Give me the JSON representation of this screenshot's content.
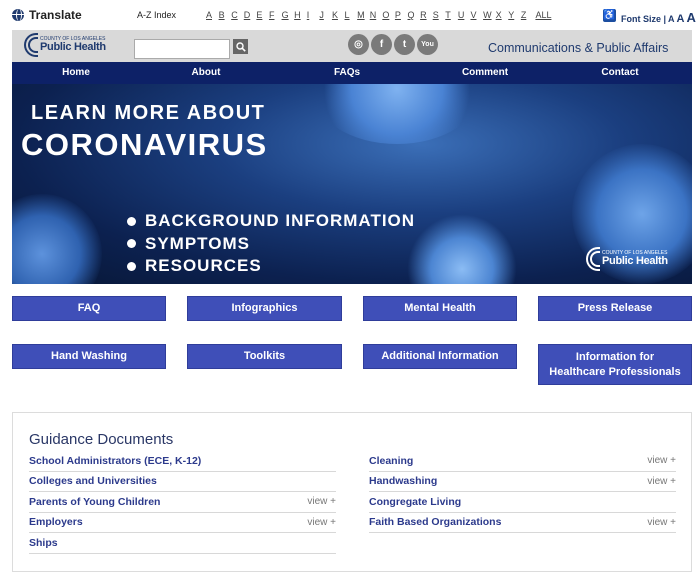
{
  "topbar": {
    "translate_label": "Translate",
    "az_label": "A-Z Index",
    "letters": [
      "A",
      "B",
      "C",
      "D",
      "E",
      "F",
      "G",
      "H",
      "I",
      "J",
      "K",
      "L",
      "M",
      "N",
      "O",
      "P",
      "Q",
      "R",
      "S",
      "T",
      "U",
      "V",
      "W",
      "X",
      "Y",
      "Z"
    ],
    "all_label": "ALL",
    "font_size_label": "Font Size |",
    "font_size_options": [
      "A",
      "A",
      "A"
    ]
  },
  "header": {
    "logo_small": "COUNTY OF LOS ANGELES",
    "logo_big": "Public Health",
    "search": {
      "value": "",
      "placeholder": ""
    },
    "social_icons": [
      "instagram-icon",
      "facebook-icon",
      "twitter-icon",
      "youtube-icon"
    ],
    "social_glyphs": [
      "◎",
      "f",
      "t",
      "You"
    ],
    "dept_title": "Communications & Public Affairs"
  },
  "nav": {
    "items": [
      "Home",
      "About",
      "FAQs",
      "Comment",
      "Contact"
    ]
  },
  "hero": {
    "line1": "LEARN MORE ABOUT",
    "line2": "CORONAVIRUS",
    "bullets": [
      "BACKGROUND INFORMATION",
      "SYMPTOMS",
      "RESOURCES"
    ],
    "logo_small": "COUNTY OF LOS ANGELES",
    "logo_big": "Public Health"
  },
  "buttons": {
    "row1": [
      "FAQ",
      "Infographics",
      "Mental Health",
      "Press Release"
    ],
    "row2": [
      "Hand Washing",
      "Toolkits",
      "Additional Information",
      "Information for Healthcare Professionals"
    ]
  },
  "guidance": {
    "title": "Guidance Documents",
    "left": [
      {
        "label": "School Administrators (ECE, K-12)",
        "view": ""
      },
      {
        "label": "Colleges and Universities",
        "view": ""
      },
      {
        "label": "Parents of Young Children",
        "view": "view +"
      },
      {
        "label": "Employers",
        "view": "view +"
      },
      {
        "label": "Ships",
        "view": ""
      }
    ],
    "right": [
      {
        "label": "Cleaning",
        "view": "view +"
      },
      {
        "label": "Handwashing",
        "view": "view +"
      },
      {
        "label": "Congregate Living",
        "view": ""
      },
      {
        "label": "Faith Based Organizations",
        "view": "view +"
      }
    ]
  },
  "colors": {
    "nav_bg": "#0d2167",
    "button_bg": "#3f4fb8",
    "brand_text": "#1f3a6e",
    "link_text": "#2c3a8c"
  }
}
